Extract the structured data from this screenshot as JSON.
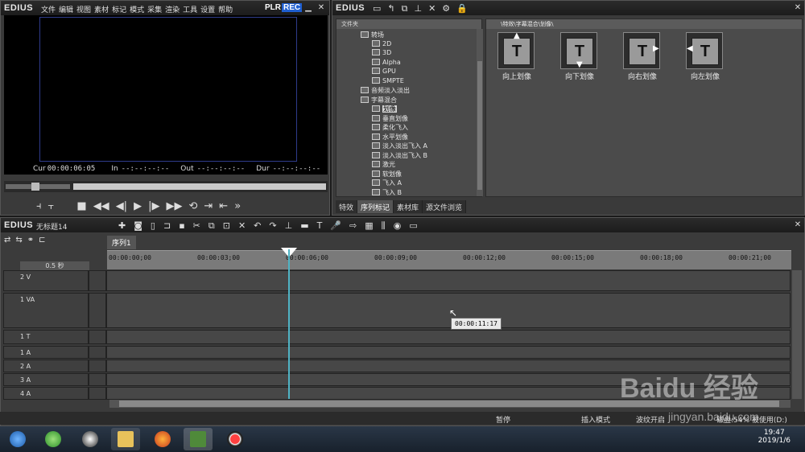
{
  "player": {
    "brand": "EDIUS",
    "menu": [
      "文件",
      "编辑",
      "视图",
      "素材",
      "标记",
      "模式",
      "采集",
      "渲染",
      "工具",
      "设置",
      "帮助"
    ],
    "plr": "PLR",
    "rec": "REC",
    "cur_label": "Cur",
    "cur_value": "00:00:06:05",
    "in_label": "In",
    "in_value": "--:--:--:--",
    "out_label": "Out",
    "out_value": "--:--:--:--",
    "dur_label": "Dur",
    "dur_value": "--:--:--:--"
  },
  "effects": {
    "brand": "EDIUS",
    "tree_header": "文件夹",
    "tree": [
      {
        "label": "转场",
        "level": 0
      },
      {
        "label": "2D",
        "level": 1
      },
      {
        "label": "3D",
        "level": 1
      },
      {
        "label": "Alpha",
        "level": 1
      },
      {
        "label": "GPU",
        "level": 1
      },
      {
        "label": "SMPTE",
        "level": 1
      },
      {
        "label": "音频淡入淡出",
        "level": 0
      },
      {
        "label": "字幕混合",
        "level": 0
      },
      {
        "label": "划像",
        "level": 1,
        "selected": true
      },
      {
        "label": "垂直划像",
        "level": 1
      },
      {
        "label": "柔化飞入",
        "level": 1
      },
      {
        "label": "水平划像",
        "level": 1
      },
      {
        "label": "淡入淡出飞入 A",
        "level": 1
      },
      {
        "label": "淡入淡出飞入 B",
        "level": 1
      },
      {
        "label": "激光",
        "level": 1
      },
      {
        "label": "软划像",
        "level": 1
      },
      {
        "label": "飞入 A",
        "level": 1
      },
      {
        "label": "飞入 B",
        "level": 1
      }
    ],
    "crumb": "\\特效\\字幕混合\\划像\\",
    "cards": [
      {
        "label": "向上划像",
        "arrow": "▲"
      },
      {
        "label": "向下划像",
        "arrow": "▼"
      },
      {
        "label": "向右划像",
        "arrow": "▶"
      },
      {
        "label": "向左划像",
        "arrow": "◀"
      }
    ],
    "tabs": [
      "特效",
      "序列标记",
      "素材库",
      "源文件浏览"
    ]
  },
  "timeline": {
    "brand": "EDIUS",
    "project": "无标题14",
    "sequence_tab": "序列1",
    "zoom": "0.5 秒",
    "ruler": [
      "00:00:00;00",
      "00:00:03;00",
      "00:00:06;00",
      "00:00:09;00",
      "00:00:12;00",
      "00:00:15;00",
      "00:00:18;00",
      "00:00:21;00"
    ],
    "tracks": [
      {
        "name": "2 V"
      },
      {
        "name": "1 VA"
      },
      {
        "name": "1 T"
      },
      {
        "name": "1 A"
      },
      {
        "name": "2 A"
      },
      {
        "name": "3 A"
      },
      {
        "name": "4 A"
      }
    ],
    "tooltip": "00:00:11:17"
  },
  "status": {
    "stop": "暂停",
    "insert": "插入模式",
    "ripple": "波纹开启",
    "disk": "磁盘:54% 被使用(D:)"
  },
  "taskbar": {
    "time": "19:47",
    "date": "2019/1/6"
  },
  "watermark": {
    "logo": "Baidu 经验",
    "url": "jingyan.baidu.com"
  }
}
